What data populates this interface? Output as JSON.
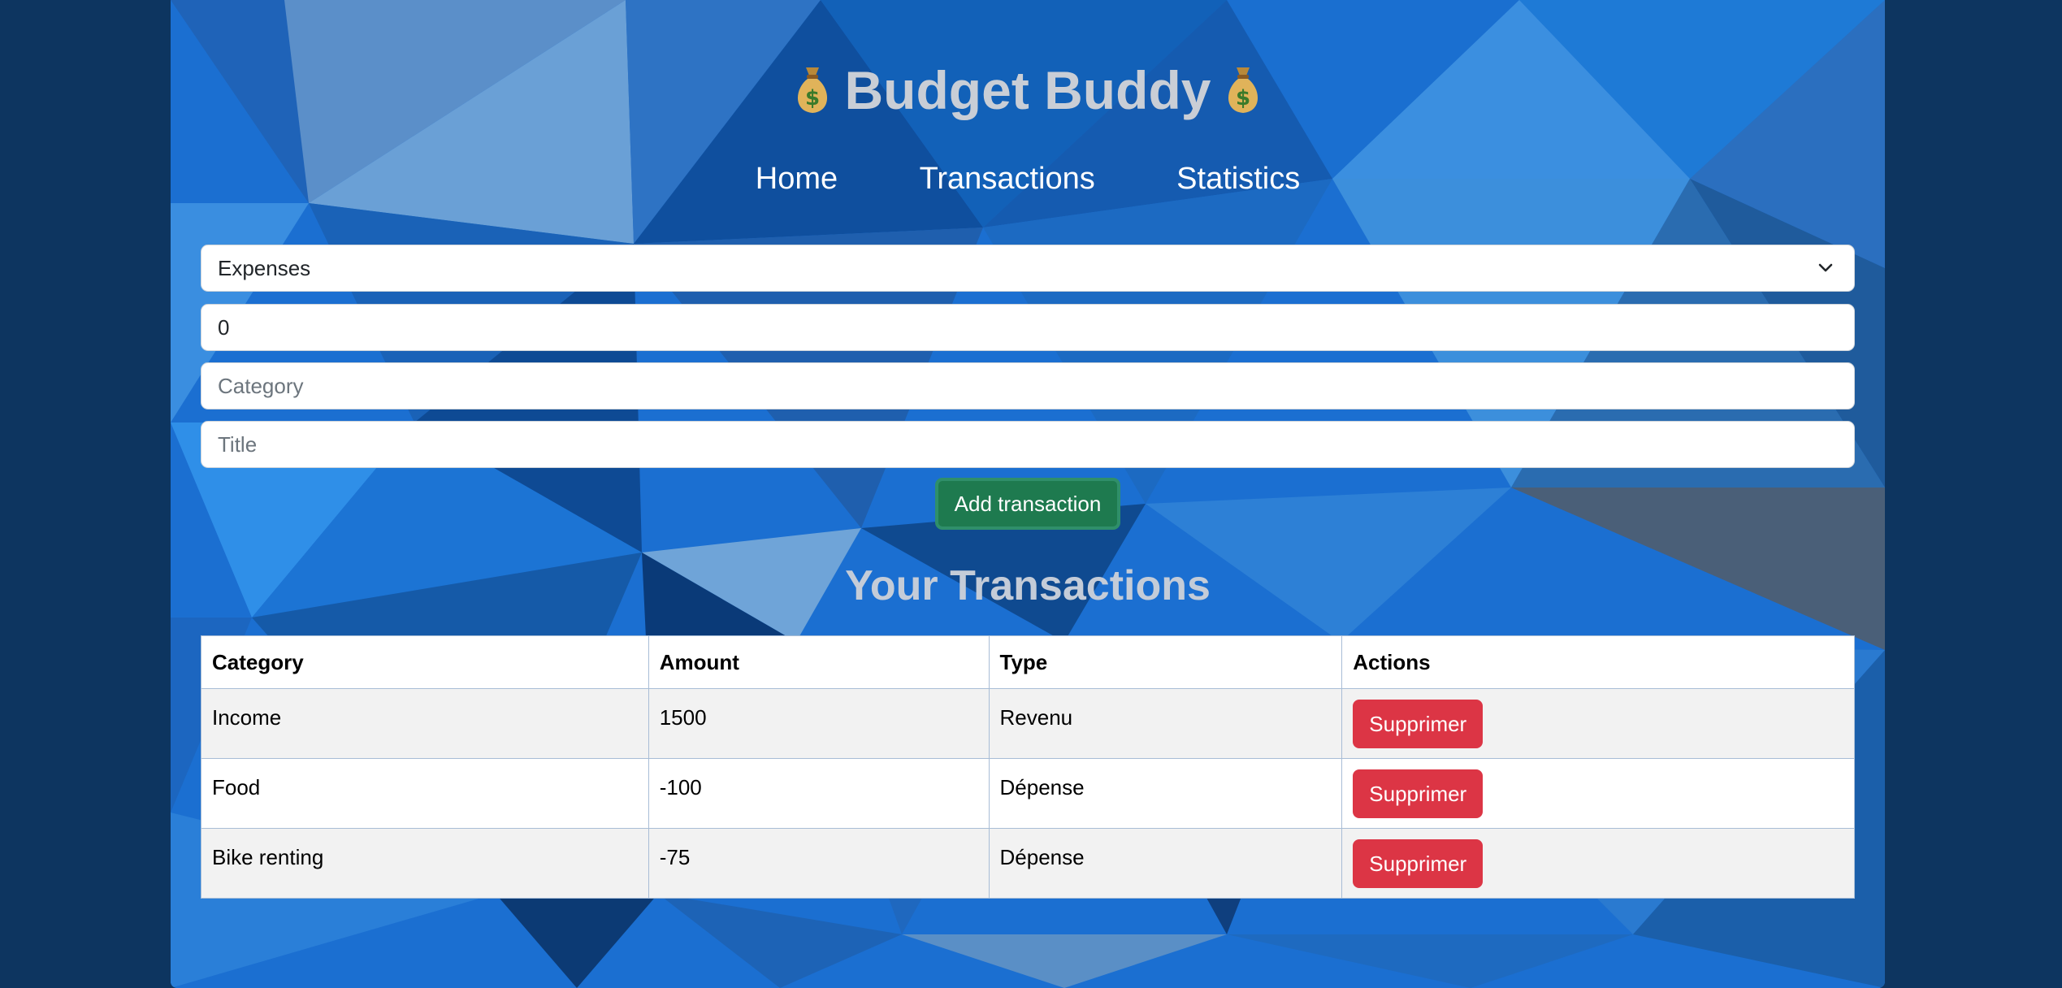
{
  "app": {
    "title": "Budget Buddy",
    "bag_icon": "money-bag-icon"
  },
  "nav": {
    "items": [
      {
        "label": "Home"
      },
      {
        "label": "Transactions"
      },
      {
        "label": "Statistics"
      }
    ]
  },
  "form": {
    "type_select": {
      "value": "Expenses"
    },
    "amount_input": {
      "value": "0"
    },
    "category_input": {
      "placeholder": "Category"
    },
    "title_input": {
      "placeholder": "Title"
    },
    "submit_label": "Add transaction"
  },
  "transactions": {
    "heading": "Your Transactions",
    "columns": [
      "Category",
      "Amount",
      "Type",
      "Actions"
    ],
    "rows": [
      {
        "category": "Income",
        "amount": "1500",
        "type": "Revenu",
        "action": "Supprimer"
      },
      {
        "category": "Food",
        "amount": "-100",
        "type": "Dépense",
        "action": "Supprimer"
      },
      {
        "category": "Bike renting",
        "amount": "-75",
        "type": "Dépense",
        "action": "Supprimer"
      }
    ]
  },
  "colors": {
    "page_bg": "#0d3560",
    "panel_blue": "#1a6fd0",
    "add_button": "#1e7a4f",
    "delete_button": "#dc3545",
    "title_text": "#c9ced6"
  }
}
